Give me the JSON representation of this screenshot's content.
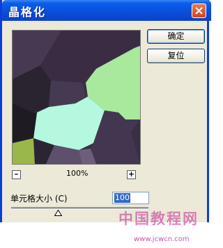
{
  "window": {
    "title": "晶格化"
  },
  "buttons": {
    "ok_label": "确定",
    "reset_label": "复位"
  },
  "zoom": {
    "minus": "–",
    "plus": "+",
    "level": "100%"
  },
  "cell_size": {
    "label": "单元格大小 (C)",
    "value": "100"
  },
  "watermark": {
    "text": "中国教程网",
    "url": "www.jcwcn.com"
  },
  "icons": {
    "close": "close-icon",
    "slider_thumb": "triangle-up-icon"
  },
  "colors": {
    "title_bar": "#0a4fdc",
    "dialog_bg": "#ece9d8",
    "close_button": "#d2421e",
    "selection": "#316ac5",
    "watermark": "#be2896"
  }
}
